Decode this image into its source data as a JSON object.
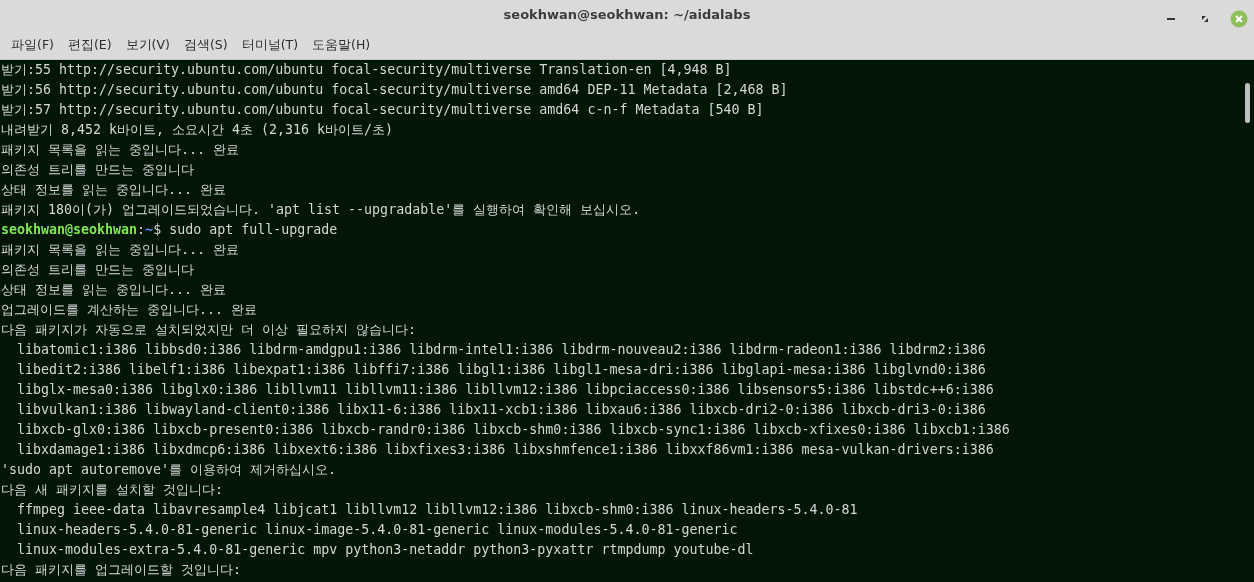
{
  "window": {
    "title": "seokhwan@seokhwan: ~/aidalabs"
  },
  "menu": [
    "파일(F)",
    "편집(E)",
    "보기(V)",
    "검색(S)",
    "터미널(T)",
    "도움말(H)"
  ],
  "lines": [
    {
      "kind": "output",
      "text": "받기:55 http://security.ubuntu.com/ubuntu focal-security/multiverse Translation-en [4,948 B]"
    },
    {
      "kind": "output",
      "text": "받기:56 http://security.ubuntu.com/ubuntu focal-security/multiverse amd64 DEP-11 Metadata [2,468 B]"
    },
    {
      "kind": "output",
      "text": "받기:57 http://security.ubuntu.com/ubuntu focal-security/multiverse amd64 c-n-f Metadata [540 B]"
    },
    {
      "kind": "output",
      "text": "내려받기 8,452 k바이트, 소요시간 4초 (2,316 k바이트/초)"
    },
    {
      "kind": "output",
      "text": "패키지 목록을 읽는 중입니다... 완료"
    },
    {
      "kind": "output",
      "text": "의존성 트리를 만드는 중입니다"
    },
    {
      "kind": "output",
      "text": "상태 정보를 읽는 중입니다... 완료"
    },
    {
      "kind": "output",
      "text": "패키지 180이(가) 업그레이드되었습니다. 'apt list --upgradable'를 실행하여 확인해 보십시오."
    },
    {
      "kind": "prompt",
      "user_host": "seokhwan@seokhwan",
      "separator": ":",
      "path": "~",
      "command": "$ sudo apt full-upgrade"
    },
    {
      "kind": "output",
      "text": "패키지 목록을 읽는 중입니다... 완료"
    },
    {
      "kind": "output",
      "text": "의존성 트리를 만드는 중입니다"
    },
    {
      "kind": "output",
      "text": "상태 정보를 읽는 중입니다... 완료"
    },
    {
      "kind": "output",
      "text": "업그레이드를 계산하는 중입니다... 완료"
    },
    {
      "kind": "output",
      "text": "다음 패키지가 자동으로 설치되었지만 더 이상 필요하지 않습니다:"
    },
    {
      "kind": "output",
      "text": "  libatomic1:i386 libbsd0:i386 libdrm-amdgpu1:i386 libdrm-intel1:i386 libdrm-nouveau2:i386 libdrm-radeon1:i386 libdrm2:i386"
    },
    {
      "kind": "output",
      "text": "  libedit2:i386 libelf1:i386 libexpat1:i386 libffi7:i386 libgl1:i386 libgl1-mesa-dri:i386 libglapi-mesa:i386 libglvnd0:i386"
    },
    {
      "kind": "output",
      "text": "  libglx-mesa0:i386 libglx0:i386 libllvm11 libllvm11:i386 libllvm12:i386 libpciaccess0:i386 libsensors5:i386 libstdc++6:i386"
    },
    {
      "kind": "output",
      "text": "  libvulkan1:i386 libwayland-client0:i386 libx11-6:i386 libx11-xcb1:i386 libxau6:i386 libxcb-dri2-0:i386 libxcb-dri3-0:i386"
    },
    {
      "kind": "output",
      "text": "  libxcb-glx0:i386 libxcb-present0:i386 libxcb-randr0:i386 libxcb-shm0:i386 libxcb-sync1:i386 libxcb-xfixes0:i386 libxcb1:i386"
    },
    {
      "kind": "output",
      "text": "  libxdamage1:i386 libxdmcp6:i386 libxext6:i386 libxfixes3:i386 libxshmfence1:i386 libxxf86vm1:i386 mesa-vulkan-drivers:i386"
    },
    {
      "kind": "output",
      "text": "'sudo apt autoremove'를 이용하여 제거하십시오."
    },
    {
      "kind": "output",
      "text": "다음 새 패키지를 설치할 것입니다:"
    },
    {
      "kind": "output",
      "text": "  ffmpeg ieee-data libavresample4 libjcat1 libllvm12 libllvm12:i386 libxcb-shm0:i386 linux-headers-5.4.0-81"
    },
    {
      "kind": "output",
      "text": "  linux-headers-5.4.0-81-generic linux-image-5.4.0-81-generic linux-modules-5.4.0-81-generic"
    },
    {
      "kind": "output",
      "text": "  linux-modules-extra-5.4.0-81-generic mpv python3-netaddr python3-pyxattr rtmpdump youtube-dl"
    },
    {
      "kind": "output",
      "text": "다음 패키지를 업그레이드할 것입니다:"
    }
  ]
}
